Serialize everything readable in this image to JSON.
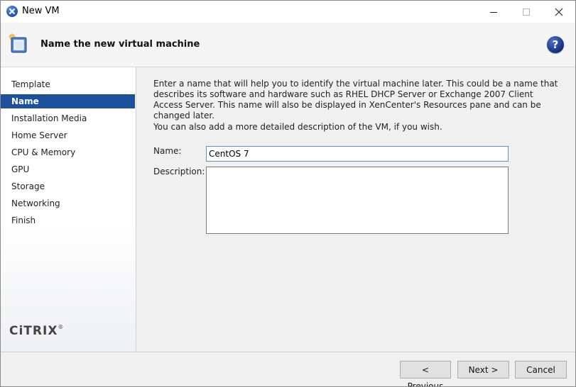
{
  "window": {
    "title": "New VM"
  },
  "header": {
    "title": "Name the new virtual machine",
    "help": "?"
  },
  "sidebar": {
    "items": [
      {
        "label": "Template"
      },
      {
        "label": "Name",
        "active": true
      },
      {
        "label": "Installation Media"
      },
      {
        "label": "Home Server"
      },
      {
        "label": "CPU & Memory"
      },
      {
        "label": "GPU"
      },
      {
        "label": "Storage"
      },
      {
        "label": "Networking"
      },
      {
        "label": "Finish"
      }
    ],
    "logo": "CiTRIX",
    "logo_mark": "®"
  },
  "content": {
    "intro": "Enter a name that will help you to identify the virtual machine later. This could be a name that describes its software and hardware such as RHEL DHCP Server or Exchange 2007 Client Access Server. This name will also be displayed in XenCenter's Resources pane and can be changed later.",
    "description_hint": "You can also add a more detailed description of the VM, if you wish.",
    "name_label": "Name:",
    "name_value": "CentOS 7",
    "description_label": "Description:",
    "description_value": ""
  },
  "footer": {
    "previous_label": "< Previous",
    "next_label": "Next >",
    "cancel_label": "Cancel"
  },
  "colors": {
    "accent": "#1c4f9c",
    "input_border": "#5f8fc9",
    "help": "#1a3a9a"
  },
  "icons": [
    "xencenter-app-icon",
    "minimize-icon",
    "maximize-icon",
    "close-icon",
    "vm-wizard-icon",
    "help-icon"
  ]
}
